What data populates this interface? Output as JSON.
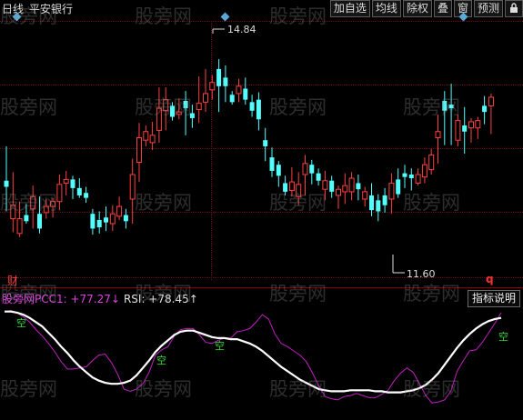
{
  "header": {
    "period": "日线",
    "stock_name": "平安银行"
  },
  "toolbar": {
    "add_watch": "加自选",
    "ma_line": "均线",
    "ex_rights": "除权",
    "overlay": "叠",
    "window": "窗",
    "forecast": "预测",
    "lock_icon": "lock-icon"
  },
  "chart": {
    "high_label": "14.84",
    "low_label": "11.60",
    "finance_marker": "财",
    "q_marker": "q",
    "up_color": "#ff4040",
    "down_color": "#54ffff",
    "grid_color": "#6b1010"
  },
  "indicator": {
    "legend_line1": "股旁网PCC1: +77.27↓",
    "legend_line2": "RSI: +78.45↑",
    "help_button": "指标说明",
    "short_marker": "空",
    "line1_color": "#c020c0",
    "line2_color": "#ffffff"
  },
  "watermark": "股旁网",
  "chart_data": {
    "type": "candlestick",
    "y_labels": {
      "max": 14.84,
      "min": 11.6
    },
    "candles": [
      [
        50.0,
        75.0,
        70.0,
        103.0,
        "down"
      ],
      [
        33.0,
        55.0,
        44.0,
        82.0,
        "up"
      ],
      [
        29.0,
        44.0,
        32.0,
        58.0,
        "up"
      ],
      [
        40.0,
        47.0,
        42.0,
        56.0,
        "down"
      ],
      [
        36.0,
        62.0,
        52.0,
        71.0,
        "up"
      ],
      [
        32.0,
        48.0,
        36.0,
        62.0,
        "down"
      ],
      [
        44.0,
        54.0,
        49.0,
        60.0,
        "up"
      ],
      [
        45.0,
        58.0,
        54.0,
        61.0,
        "up"
      ],
      [
        51.0,
        72.0,
        58.0,
        80.0,
        "up"
      ],
      [
        63.0,
        76.0,
        73.0,
        83.0,
        "up"
      ],
      [
        60.0,
        76.0,
        69.0,
        79.0,
        "down"
      ],
      [
        61.0,
        69.0,
        63.0,
        77.0,
        "down"
      ],
      [
        57.0,
        65.0,
        61.0,
        70.0,
        "down"
      ],
      [
        31.0,
        48.0,
        36.0,
        52.0,
        "down"
      ],
      [
        32.0,
        43.0,
        37.0,
        50.0,
        "down"
      ],
      [
        34.0,
        45.0,
        41.0,
        54.0,
        "down"
      ],
      [
        34.0,
        48.0,
        40.0,
        55.0,
        "up"
      ],
      [
        43.0,
        54.0,
        46.0,
        62.0,
        "up"
      ],
      [
        36.0,
        47.0,
        42.0,
        52.0,
        "down"
      ],
      [
        40.0,
        80.0,
        60.0,
        93.0,
        "up"
      ],
      [
        74.0,
        110.0,
        90.0,
        122.0,
        "up"
      ],
      [
        103.0,
        115.0,
        108.0,
        120.0,
        "up"
      ],
      [
        100.0,
        112.0,
        106.0,
        123.0,
        "up"
      ],
      [
        106.0,
        134.0,
        116.0,
        151.0,
        "up"
      ],
      [
        116.0,
        141.0,
        132.0,
        151.0,
        "up"
      ],
      [
        124.0,
        136.0,
        127.0,
        139.0,
        "down"
      ],
      [
        125.0,
        131.0,
        129.0,
        142.0,
        "up"
      ],
      [
        112.0,
        140.0,
        134.0,
        148.0,
        "down"
      ],
      [
        118.0,
        130.0,
        126.0,
        137.0,
        "down"
      ],
      [
        122.0,
        138.0,
        133.0,
        160.0,
        "up"
      ],
      [
        131.0,
        146.0,
        139.0,
        166.0,
        "up"
      ],
      [
        141.0,
        155.0,
        149.0,
        161.0,
        "up"
      ],
      [
        131.0,
        166.0,
        152.0,
        174.0,
        "down"
      ],
      [
        139.0,
        159.0,
        152.0,
        169.0,
        "down"
      ],
      [
        137.0,
        145.0,
        139.0,
        148.0,
        "down"
      ],
      [
        139.0,
        152.0,
        146.0,
        158.0,
        "up"
      ],
      [
        137.0,
        150.0,
        141.0,
        159.0,
        "down"
      ],
      [
        127.0,
        139.0,
        132.0,
        145.0,
        "down"
      ],
      [
        116.0,
        141.0,
        125.0,
        147.0,
        "down"
      ],
      [
        91.0,
        108.0,
        103.0,
        118.0,
        "down"
      ],
      [
        78.0,
        94.0,
        83.0,
        102.0,
        "down"
      ],
      [
        70.0,
        88.0,
        79.0,
        91.0,
        "down"
      ],
      [
        63.0,
        73.0,
        66.0,
        79.0,
        "down"
      ],
      [
        62.0,
        74.0,
        67.0,
        86.0,
        "up"
      ],
      [
        55.0,
        72.0,
        62.0,
        82.0,
        "up"
      ],
      [
        63.0,
        89.0,
        80.0,
        96.0,
        "up"
      ],
      [
        72.0,
        88.0,
        81.0,
        92.0,
        "down"
      ],
      [
        71.0,
        81.0,
        75.0,
        85.0,
        "down"
      ],
      [
        59.0,
        75.0,
        68.0,
        83.0,
        "up"
      ],
      [
        61.0,
        75.0,
        66.0,
        79.0,
        "down"
      ],
      [
        52.0,
        68.0,
        63.0,
        71.0,
        "up"
      ],
      [
        56.0,
        71.0,
        66.0,
        81.0,
        "up"
      ],
      [
        59.0,
        77.0,
        66.0,
        82.0,
        "up"
      ],
      [
        59.0,
        73.0,
        68.0,
        80.0,
        "down"
      ],
      [
        54.0,
        66.0,
        60.0,
        70.0,
        "up"
      ],
      [
        46.0,
        63.0,
        51.0,
        73.0,
        "down"
      ],
      [
        42.0,
        59.0,
        50.0,
        64.0,
        "down"
      ],
      [
        49.0,
        63.0,
        55.0,
        69.0,
        "down"
      ],
      [
        48.0,
        73.0,
        60.0,
        81.0,
        "up"
      ],
      [
        61.0,
        76.0,
        64.0,
        85.0,
        "down"
      ],
      [
        69.0,
        81.0,
        78.0,
        88.0,
        "down"
      ],
      [
        67.0,
        80.0,
        77.0,
        85.0,
        "down"
      ],
      [
        71.0,
        80.0,
        73.0,
        85.0,
        "up"
      ],
      [
        73.0,
        88.0,
        78.0,
        94.0,
        "up"
      ],
      [
        80.0,
        96.0,
        84.0,
        101.0,
        "up"
      ],
      [
        89.0,
        115.0,
        110.0,
        129.0,
        "up"
      ],
      [
        104.0,
        140.0,
        132.0,
        148.0,
        "down"
      ],
      [
        104.0,
        137.0,
        134.0,
        154.0,
        "down"
      ],
      [
        103.0,
        124.0,
        108.0,
        129.0,
        "up"
      ],
      [
        97.0,
        120.0,
        115.0,
        135.0,
        "down"
      ],
      [
        106.0,
        123.0,
        118.0,
        126.0,
        "up"
      ],
      [
        109.0,
        124.0,
        118.0,
        127.0,
        "up"
      ],
      [
        121.0,
        136.0,
        131.0,
        144.0,
        "down"
      ],
      [
        113.0,
        143.0,
        136.0,
        146.0,
        "up"
      ]
    ],
    "pcc1_series": [
      96.0,
      97.0,
      95.0,
      91.0,
      86.0,
      79.0,
      73.0,
      66.0,
      58.0,
      49.0,
      42.0,
      42.0,
      43.0,
      44.0,
      50.0,
      55.0,
      56.0,
      48.0,
      37.0,
      23.0,
      21.0,
      23.0,
      28.0,
      39.0,
      55.0,
      60.0,
      63.0,
      73.0,
      79.0,
      80.0,
      80.0,
      74.0,
      67.0,
      66.0,
      69.0,
      71.0,
      71.0,
      77.0,
      78.0,
      80.0,
      86.0,
      93.0,
      89.0,
      75.0,
      66.0,
      63.0,
      59.0,
      55.0,
      49.0,
      38.0,
      26.0,
      16.0,
      14.0,
      13.0,
      16.0,
      17.0,
      19.0,
      17.0,
      15.0,
      15.0,
      18.0,
      22.0,
      31.0,
      38.0,
      43.0,
      39.0,
      28.0,
      17.0,
      10.0,
      11.0,
      13.0,
      21.0,
      40.0,
      50.0,
      59.0,
      60.0,
      67.0,
      76.0,
      85.0,
      95.0
    ],
    "rsi_series": [
      96.0,
      96.0,
      95.0,
      93.0,
      90.0,
      86.0,
      82.0,
      76.0,
      70.0,
      63.0,
      57.0,
      50.0,
      44.0,
      39.0,
      34.0,
      31.0,
      29.0,
      28.0,
      28.0,
      29.0,
      31.0,
      36.0,
      43.0,
      50.0,
      58.0,
      64.0,
      69.0,
      74.0,
      77.0,
      78.0,
      78.0,
      76.0,
      74.0,
      72.0,
      71.0,
      71.0,
      70.0,
      70.0,
      68.0,
      66.0,
      63.0,
      59.0,
      54.0,
      49.0,
      44.0,
      40.0,
      36.0,
      32.0,
      29.0,
      26.0,
      23.0,
      22.0,
      21.0,
      21.0,
      21.0,
      22.0,
      22.0,
      22.0,
      22.0,
      21.0,
      21.0,
      20.0,
      20.0,
      20.0,
      21.0,
      22.0,
      24.0,
      27.0,
      32.0,
      38.0,
      46.0,
      54.0,
      62.0,
      69.0,
      75.0,
      80.0,
      84.0,
      87.0,
      89.0,
      90.0
    ]
  }
}
